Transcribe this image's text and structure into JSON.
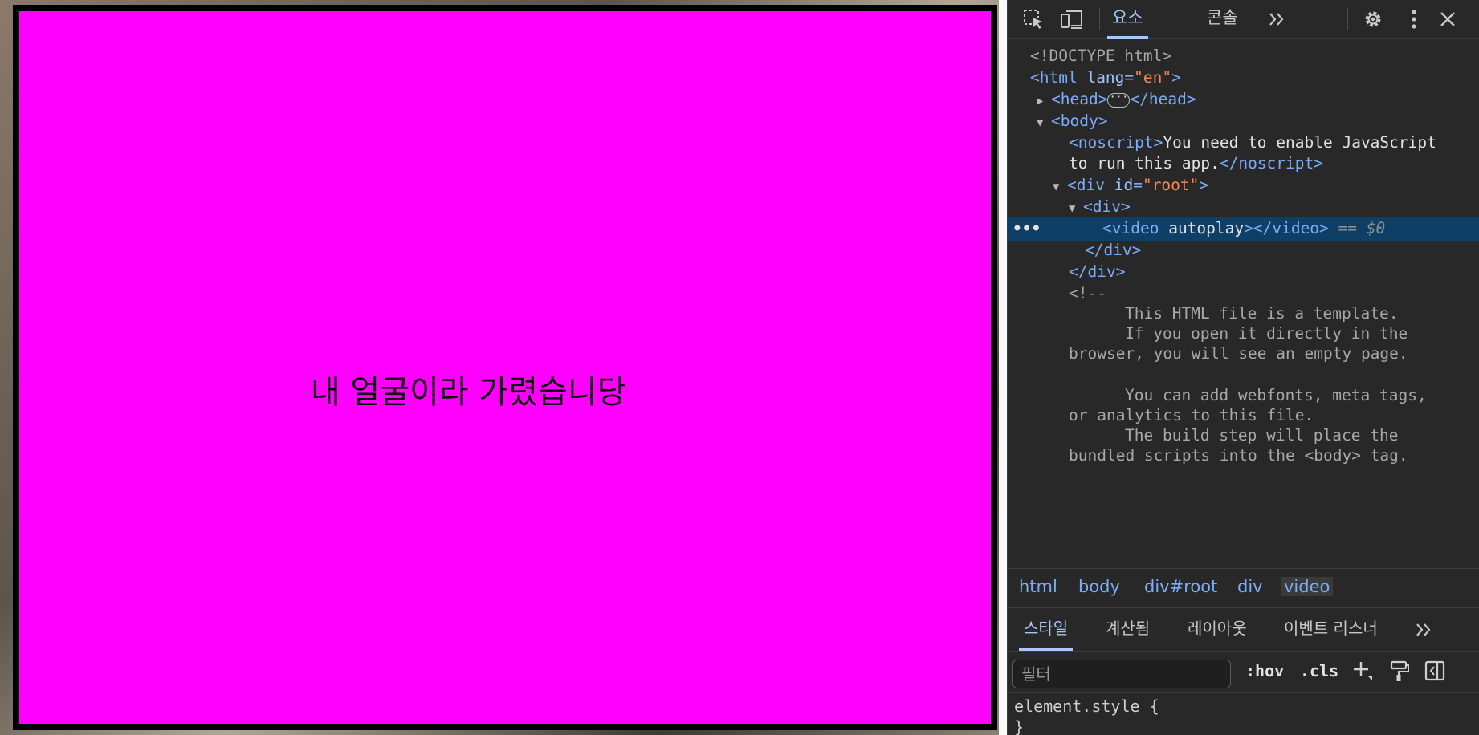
{
  "video": {
    "caption": "내 얼굴이라 가렸습니당",
    "background_color": "#ff00ff"
  },
  "devtools": {
    "toolbar": {
      "icons": [
        "inspect-element-icon",
        "device-toolbar-icon",
        "settings-gear-icon",
        "more-options-icon",
        "close-icon"
      ],
      "tabs": [
        "요소",
        "콘솔"
      ],
      "more_tabs_label": "»"
    },
    "dom": {
      "doctype": "<!DOCTYPE html>",
      "html_tag_open": "<html",
      "html_lang_attr": "lang",
      "html_lang_value": "\"en\"",
      "head_open": "<head>",
      "head_ellipsis": "···",
      "head_close": "</head>",
      "body_open": "<body>",
      "noscript_open": "<noscript>",
      "noscript_text_1": "You need to enable JavaScript",
      "noscript_text_2": "to run this app.",
      "noscript_close": "</noscript>",
      "div_root_open": "<div",
      "div_id_attr": "id",
      "div_id_value": "\"root\"",
      "div_open": "<div>",
      "video_open": "<video",
      "video_attr": "autoplay",
      "video_close": "></video>",
      "selected_marker": "== $0",
      "div_close": "</div>",
      "comment_open": "<!--",
      "comment_lines": [
        "This HTML file is a template.",
        "If you open it directly in the",
        "browser, you will see an empty page.",
        "You can add webfonts, meta tags,",
        "or analytics to this file.",
        "The build step will place the",
        "bundled scripts into the <body> tag."
      ]
    },
    "breadcrumb": [
      "html",
      "body",
      "div#root",
      "div",
      "video"
    ],
    "styles_tabs": [
      "스타일",
      "계산됨",
      "레이아웃",
      "이벤트 리스너"
    ],
    "filter_placeholder": "필터",
    "hov_label": ":hov",
    "cls_label": ".cls",
    "styles_rule": "element.style {",
    "styles_rule_close": "}"
  }
}
